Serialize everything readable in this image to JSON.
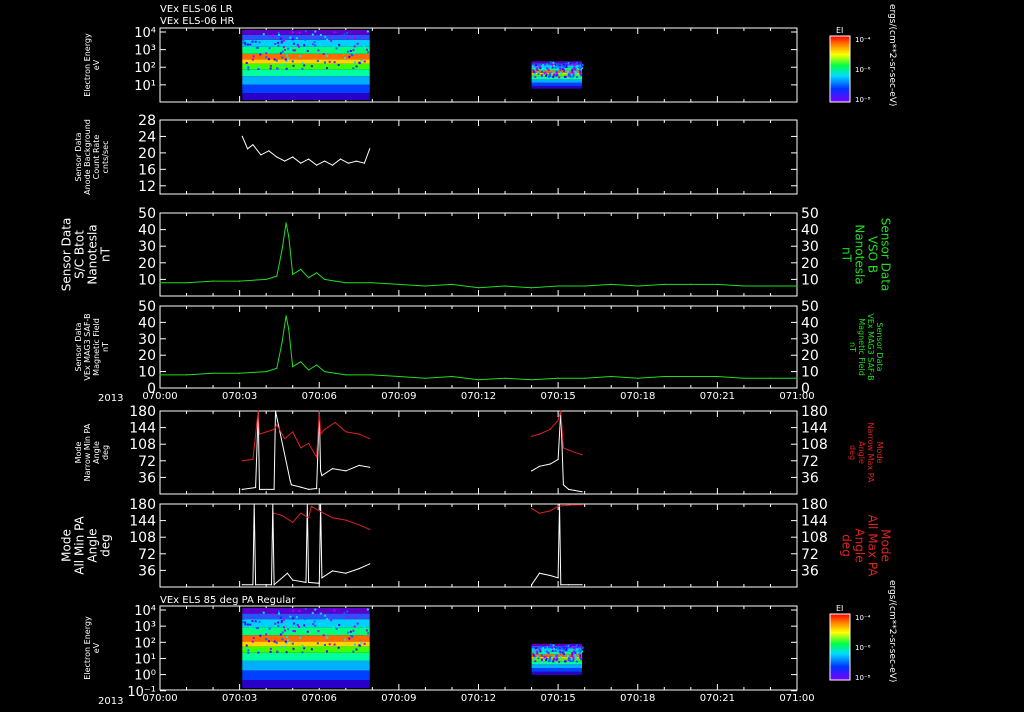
{
  "header": {
    "line1": "VEx ELS-06 LR",
    "line2": "VEx ELS-06 HR"
  },
  "footer": {
    "year": "2013",
    "spec_title": "VEx ELS 85 deg PA Regular"
  },
  "colors": {
    "background": "#000000",
    "axes": "#ffffff",
    "white_trace": "#ffffff",
    "green_trace": "#22dd22",
    "red_trace": "#dd2222",
    "green_label": "#22dd22",
    "red_label": "#dd2222"
  },
  "colorbar": {
    "label": "EI",
    "ticks": [
      "10⁻⁴",
      "10⁻⁶",
      "10⁻⁸"
    ],
    "unit_label": "ergs/(cm**2-sr-sec-eV)"
  },
  "chart_data": [
    {
      "id": "top-spectrogram",
      "type": "heatmap",
      "ylabel": [
        "Electron Energy",
        "eV"
      ],
      "y_tick_labels": [
        "10⁴",
        "10³",
        "10²",
        "10¹"
      ],
      "x_tick_labels": [],
      "blocks": [
        {
          "t_start": 3.1,
          "t_end": 7.9
        },
        {
          "t_start": 14.0,
          "t_end": 15.9
        }
      ],
      "colorscale": "rainbow"
    },
    {
      "id": "background-count",
      "type": "line",
      "ylabel": [
        "Sensor Data",
        "Anode Background",
        "Count Rate",
        "cnts/sec"
      ],
      "y_ticks": [
        12,
        16,
        20,
        24,
        28
      ],
      "ylim": [
        10,
        28
      ],
      "series": [
        {
          "color": "#ffffff",
          "x": [
            3.1,
            3.3,
            3.5,
            3.8,
            4.1,
            4.4,
            4.7,
            5.0,
            5.3,
            5.6,
            5.9,
            6.2,
            6.5,
            6.8,
            7.1,
            7.4,
            7.7,
            7.9
          ],
          "y": [
            24,
            21,
            22,
            19.5,
            20.5,
            19,
            18,
            19,
            17.5,
            18.5,
            17,
            18,
            17,
            18.5,
            17.5,
            18,
            17.5,
            21
          ]
        }
      ]
    },
    {
      "id": "bmag-sc",
      "type": "line",
      "ylabel": [
        "Sensor Data",
        "S/C Btot",
        "Nanotesla",
        "nT"
      ],
      "right_ylabel": [
        "Sensor Data",
        "VSO B",
        "Nanotesla",
        "nT"
      ],
      "y_ticks": [
        10,
        20,
        30,
        40,
        50
      ],
      "ylim": [
        0,
        50
      ],
      "series": [
        {
          "color": "#22dd22",
          "x": [
            0,
            1,
            2,
            3,
            4.0,
            4.4,
            4.6,
            4.75,
            4.85,
            5.0,
            5.3,
            5.6,
            5.9,
            6.2,
            6.6,
            7,
            8,
            9,
            10,
            11,
            12,
            13,
            14,
            15,
            16,
            17,
            18,
            19,
            20,
            21,
            22,
            23,
            24
          ],
          "y": [
            8,
            8,
            9,
            9,
            10,
            12,
            28,
            44,
            36,
            13,
            16,
            11,
            14,
            10,
            9,
            8,
            8,
            7,
            6,
            7,
            5,
            6,
            5,
            6,
            6,
            7,
            6,
            7,
            7,
            7,
            6,
            6,
            6
          ]
        }
      ]
    },
    {
      "id": "bmag-mag3",
      "type": "line",
      "ylabel": [
        "Sensor Data",
        "VEx MAG3 SAF-B",
        "Magnetic Field",
        "nT"
      ],
      "right_ylabel": [
        "Sensor Data",
        "VEx MAG3 SAF-B",
        "Magnetic Field",
        "nT"
      ],
      "y_ticks": [
        0,
        10,
        20,
        30,
        40,
        50
      ],
      "ylim": [
        0,
        50
      ],
      "x_tick_labels": [
        "070:00",
        "070:03",
        "070:06",
        "070:09",
        "070:12",
        "070:15",
        "070:18",
        "070:21",
        "071:00"
      ],
      "x_ticks_hours": [
        0,
        3,
        6,
        9,
        12,
        15,
        18,
        21,
        24
      ],
      "series": [
        {
          "color": "#22dd22",
          "x": [
            0,
            1,
            2,
            3,
            4.0,
            4.4,
            4.6,
            4.75,
            4.85,
            5.0,
            5.3,
            5.6,
            5.9,
            6.2,
            6.6,
            7,
            8,
            9,
            10,
            11,
            12,
            13,
            14,
            15,
            16,
            17,
            18,
            19,
            20,
            21,
            22,
            23,
            24
          ],
          "y": [
            8,
            8,
            9,
            9,
            10,
            12,
            28,
            44,
            36,
            13,
            16,
            11,
            14,
            10,
            9,
            8,
            8,
            7,
            6,
            7,
            5,
            6,
            5,
            6,
            6,
            7,
            6,
            7,
            7,
            7,
            6,
            6,
            6
          ]
        }
      ]
    },
    {
      "id": "narrow-pa",
      "type": "line",
      "ylabel": [
        "Mode",
        "Narrow Min PA",
        "Angle",
        "deg"
      ],
      "right_ylabel": [
        "Mode",
        "Narrow Max PA",
        "Angle",
        "deg"
      ],
      "y_ticks": [
        36,
        72,
        108,
        144,
        180
      ],
      "ylim": [
        0,
        180
      ],
      "series": [
        {
          "color": "#ffffff",
          "x": [
            3.1,
            3.6,
            3.7,
            3.75,
            4.3,
            4.35,
            4.9,
            4.95,
            5.3,
            5.6,
            5.9,
            6.0,
            6.05,
            6.1,
            6.5,
            7.0,
            7.5,
            7.9
          ],
          "y": [
            10,
            14,
            180,
            10,
            10,
            180,
            30,
            20,
            15,
            10,
            12,
            180,
            50,
            40,
            55,
            50,
            62,
            58
          ]
        },
        {
          "color": "#ffffff",
          "x": [
            14.0,
            14.3,
            14.7,
            15.0,
            15.1,
            15.2,
            15.4,
            15.9
          ],
          "y": [
            50,
            60,
            65,
            75,
            180,
            20,
            10,
            5
          ]
        },
        {
          "color": "#dd2222",
          "x": [
            3.1,
            3.5,
            3.7,
            3.75,
            4.3,
            4.4,
            4.7,
            5.0,
            5.3,
            5.6,
            5.9,
            6.0,
            6.05,
            6.2,
            6.6,
            7.0,
            7.5,
            7.9
          ],
          "y": [
            72,
            75,
            180,
            130,
            140,
            150,
            120,
            135,
            100,
            110,
            80,
            180,
            130,
            140,
            155,
            135,
            130,
            120
          ]
        },
        {
          "color": "#dd2222",
          "x": [
            14.0,
            14.3,
            14.7,
            15.0,
            15.1,
            15.2,
            15.4,
            15.9
          ],
          "y": [
            125,
            130,
            140,
            160,
            180,
            100,
            95,
            85
          ]
        }
      ]
    },
    {
      "id": "all-pa",
      "type": "line",
      "ylabel": [
        "Mode",
        "All Min PA",
        "Angle",
        "deg"
      ],
      "right_ylabel": [
        "Mode",
        "All Max PA",
        "Angle",
        "deg"
      ],
      "y_ticks": [
        36,
        72,
        108,
        144,
        180
      ],
      "ylim": [
        0,
        180
      ],
      "series": [
        {
          "color": "#ffffff",
          "x": [
            3.1,
            3.5,
            3.55,
            3.6,
            4.2,
            4.25,
            4.3,
            4.8,
            5.0,
            5.5,
            5.55,
            5.6,
            6.0,
            6.05,
            6.1,
            6.5,
            7.0,
            7.5,
            7.9
          ],
          "y": [
            5,
            5,
            180,
            5,
            5,
            180,
            5,
            30,
            15,
            10,
            180,
            10,
            8,
            180,
            20,
            35,
            30,
            40,
            50
          ]
        },
        {
          "color": "#ffffff",
          "x": [
            14.0,
            14.3,
            14.7,
            15.0,
            15.05,
            15.1,
            15.4,
            15.9
          ],
          "y": [
            5,
            30,
            25,
            20,
            180,
            5,
            5,
            5
          ]
        },
        {
          "color": "#dd2222",
          "x": [
            4.3,
            4.6,
            5.0,
            5.3,
            5.6,
            5.7,
            6.0,
            6.5,
            7.0,
            7.5,
            7.9
          ],
          "y": [
            160,
            155,
            140,
            160,
            150,
            175,
            165,
            150,
            145,
            135,
            125
          ]
        },
        {
          "color": "#dd2222",
          "x": [
            14.0,
            14.3,
            14.7,
            15.0,
            15.5,
            15.9
          ],
          "y": [
            170,
            160,
            165,
            175,
            178,
            178
          ]
        }
      ]
    },
    {
      "id": "bottom-spectrogram",
      "type": "heatmap",
      "ylabel": [
        "Electron Energy",
        "eV"
      ],
      "y_tick_labels": [
        "10⁴",
        "10³",
        "10²",
        "10¹",
        "10⁰",
        "10⁻¹"
      ],
      "x_tick_labels": [
        "070:00",
        "070:03",
        "070:06",
        "070:09",
        "070:12",
        "070:15",
        "070:18",
        "070:21",
        "071:00"
      ],
      "x_ticks_hours": [
        0,
        3,
        6,
        9,
        12,
        15,
        18,
        21,
        24
      ],
      "blocks": [
        {
          "t_start": 3.1,
          "t_end": 7.9
        },
        {
          "t_start": 14.0,
          "t_end": 15.9
        }
      ],
      "colorscale": "rainbow"
    }
  ]
}
